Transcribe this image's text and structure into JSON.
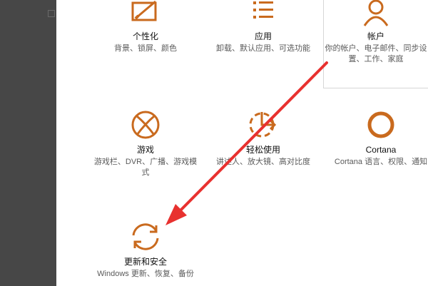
{
  "colors": {
    "accent": "#c96a1e",
    "annotation_arrow": "#e8312f",
    "sidebar": "#474747"
  },
  "tiles": [
    {
      "title": "个性化",
      "desc": "背景、锁屏、颜色",
      "icon": "personalization-icon"
    },
    {
      "title": "应用",
      "desc": "卸载、默认应用、可选功能",
      "icon": "apps-icon"
    },
    {
      "title": "帐户",
      "desc": "你的帐户、电子邮件、同步设置、工作、家庭",
      "icon": "account-icon"
    },
    {
      "title": "游戏",
      "desc": "游戏栏、DVR、广播、游戏模式",
      "icon": "xbox-icon"
    },
    {
      "title": "轻松使用",
      "desc": "讲述人、放大镜、高对比度",
      "icon": "ease-of-access-icon"
    },
    {
      "title": "Cortana",
      "desc": "Cortana 语言、权限、通知",
      "icon": "cortana-icon"
    },
    {
      "title": "更新和安全",
      "desc": "Windows 更新、恢复、备份",
      "icon": "update-sync-icon"
    }
  ]
}
